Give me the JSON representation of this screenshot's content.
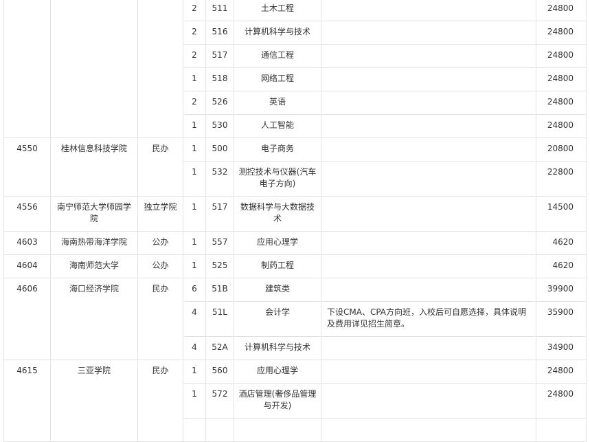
{
  "rows": [
    {
      "plan": "2",
      "major_code": "511",
      "major_name": "土木工程",
      "note": "",
      "fee": "24800"
    },
    {
      "plan": "2",
      "major_code": "516",
      "major_name": "计算机科学与技术",
      "note": "",
      "fee": "24800"
    },
    {
      "plan": "2",
      "major_code": "517",
      "major_name": "通信工程",
      "note": "",
      "fee": "24800"
    },
    {
      "plan": "1",
      "major_code": "518",
      "major_name": "网络工程",
      "note": "",
      "fee": "24800"
    },
    {
      "plan": "2",
      "major_code": "526",
      "major_name": "英语",
      "note": "",
      "fee": "24800"
    },
    {
      "plan": "1",
      "major_code": "530",
      "major_name": "人工智能",
      "note": "",
      "fee": "24800"
    },
    {
      "school_code": "4550",
      "school_name": "桂林信息科技学院",
      "school_type": "民办",
      "plan": "1",
      "major_code": "500",
      "major_name": "电子商务",
      "note": "",
      "fee": "20800"
    },
    {
      "plan": "1",
      "major_code": "532",
      "major_name": "测控技术与仪器(汽车电子方向)",
      "note": "",
      "fee": "22800"
    },
    {
      "school_code": "4556",
      "school_name": "南宁师范大学师园学院",
      "school_type": "独立学院",
      "plan": "1",
      "major_code": "517",
      "major_name": "数据科学与大数据技术",
      "note": "",
      "fee": "14500"
    },
    {
      "school_code": "4603",
      "school_name": "海南热带海洋学院",
      "school_type": "公办",
      "plan": "1",
      "major_code": "557",
      "major_name": "应用心理学",
      "note": "",
      "fee": "4620"
    },
    {
      "school_code": "4604",
      "school_name": "海南师范大学",
      "school_type": "公办",
      "plan": "1",
      "major_code": "525",
      "major_name": "制药工程",
      "note": "",
      "fee": "4620"
    },
    {
      "school_code": "4606",
      "school_name": "海口经济学院",
      "school_type": "民办",
      "plan": "6",
      "major_code": "51B",
      "major_name": "建筑类",
      "note": "",
      "fee": "39900"
    },
    {
      "plan": "4",
      "major_code": "51L",
      "major_name": "会计学",
      "note": "下设CMA、CPA方向班，入校后可自愿选择，具体说明及费用详见招生简章。",
      "fee": "35900"
    },
    {
      "plan": "4",
      "major_code": "52A",
      "major_name": "计算机科学与技术",
      "note": "",
      "fee": "34900"
    },
    {
      "school_code": "4615",
      "school_name": "三亚学院",
      "school_type": "民办",
      "plan": "1",
      "major_code": "560",
      "major_name": "应用心理学",
      "note": "",
      "fee": "24800"
    },
    {
      "plan": "1",
      "major_code": "572",
      "major_name": "酒店管理(奢侈品管理与开发)",
      "note": "",
      "fee": "24800"
    },
    {
      "plan": "",
      "major_code": "",
      "major_name": "",
      "note": "",
      "fee": ""
    }
  ]
}
